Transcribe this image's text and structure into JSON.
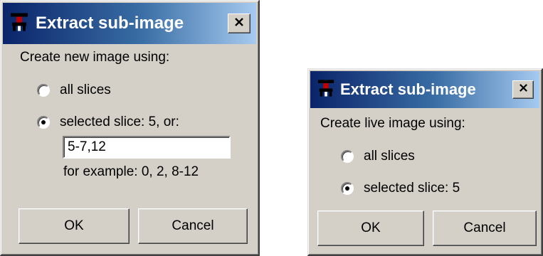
{
  "dialog1": {
    "title": "Extract sub-image",
    "prompt": "Create new image using:",
    "options": [
      {
        "label": "all slices",
        "selected": false
      },
      {
        "label": "selected slice: 5, or:",
        "selected": true
      }
    ],
    "range_input_value": "5-7,12",
    "example_text": "for example:  0, 2, 8-12",
    "ok_label": "OK",
    "cancel_label": "Cancel"
  },
  "dialog2": {
    "title": "Extract sub-image",
    "prompt": "Create live image using:",
    "options": [
      {
        "label": "all slices",
        "selected": false
      },
      {
        "label": "selected slice: 5",
        "selected": true
      }
    ],
    "ok_label": "OK",
    "cancel_label": "Cancel"
  },
  "icons": {
    "app_icon": "microscope-app-icon",
    "close_icon": "close-icon"
  },
  "colors": {
    "titlebar_start": "#0a246a",
    "titlebar_end": "#a6caf0",
    "dialog_face": "#d4d0c8"
  }
}
